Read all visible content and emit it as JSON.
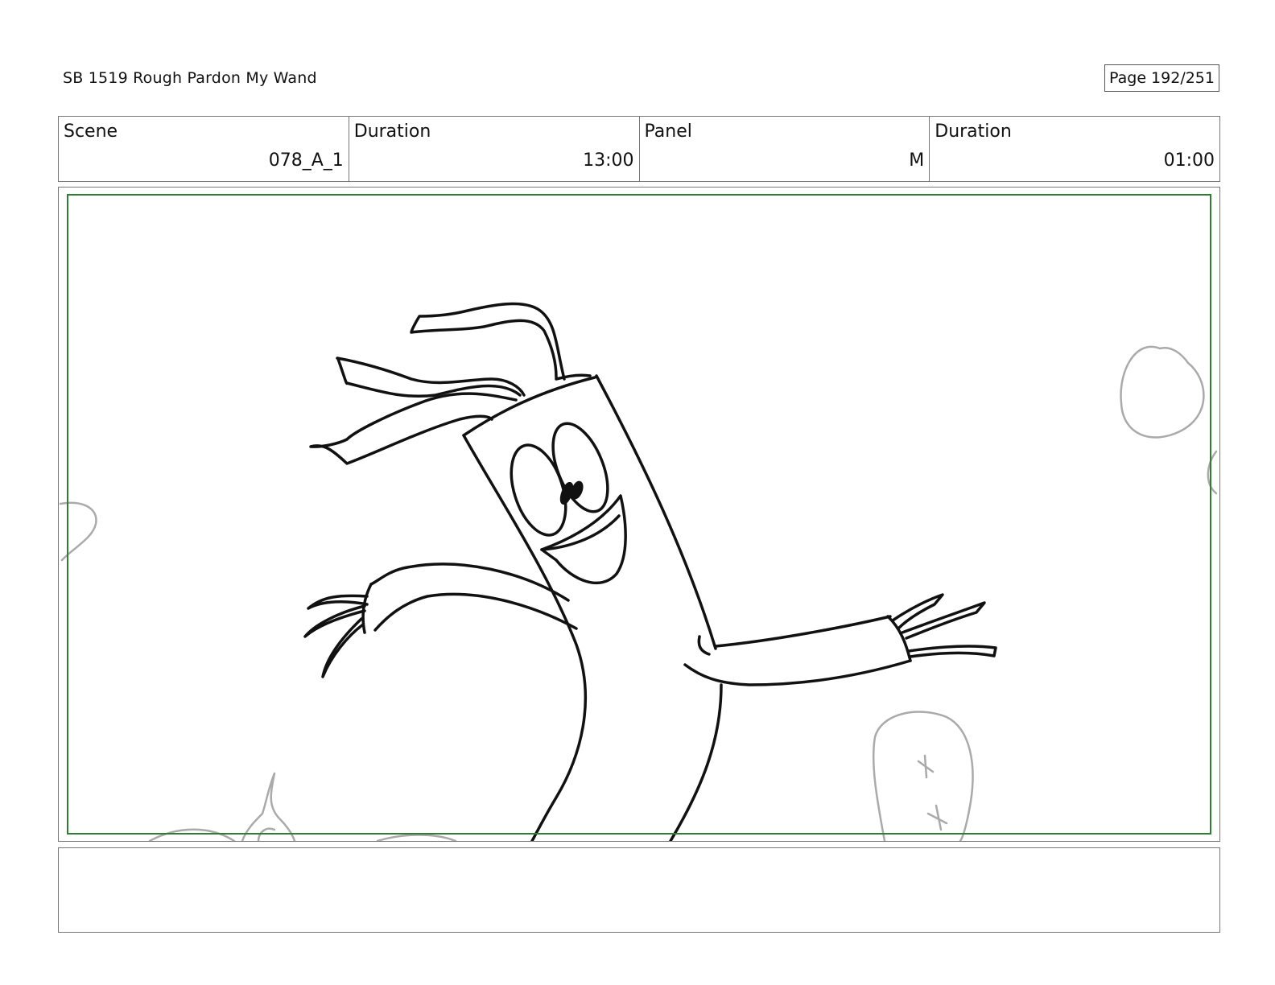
{
  "header": {
    "title": "SB 1519 Rough  Pardon My Wand",
    "page": "Page 192/251"
  },
  "info": {
    "scene_label": "Scene",
    "scene_value": "078_A_1",
    "duration_label": "Duration",
    "duration_value": "13:00",
    "panel_label": "Panel",
    "panel_value": "M",
    "panel_duration_label": "Duration",
    "panel_duration_value": "01:00"
  },
  "panel": {
    "description": "",
    "frame_color": "#2e7d32"
  },
  "notes": {
    "text": ""
  }
}
